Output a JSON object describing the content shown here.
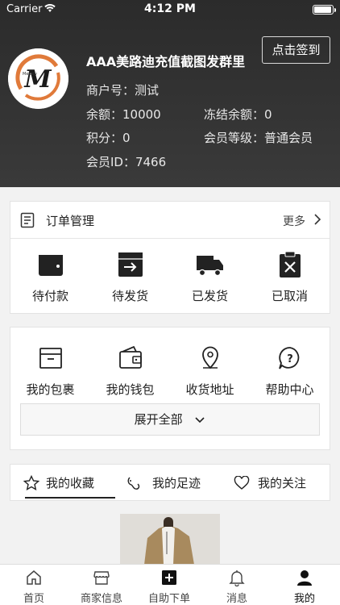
{
  "status_bar": {
    "carrier": "Carrier",
    "time": "4:12 PM",
    "battery_percent": 95
  },
  "profile": {
    "shop_name": "AAA美路迪充值截图发群里",
    "merchant_no": "商户号：测试",
    "balance": "余额：10000",
    "frozen_balance": "冻结余额：0",
    "points": "积分：0",
    "member_level": "会员等级：普通会员",
    "member_id": "会员ID：7466",
    "checkin_label": "点击签到",
    "avatar_text": "M",
    "avatar_small_text": "Melody"
  },
  "orders": {
    "title": "订单管理",
    "more_label": "更多",
    "items": [
      {
        "label": "待付款",
        "icon": "wallet-icon"
      },
      {
        "label": "待发货",
        "icon": "box-arrow-icon"
      },
      {
        "label": "已发货",
        "icon": "truck-icon"
      },
      {
        "label": "已取消",
        "icon": "cancelled-clipboard-icon"
      }
    ]
  },
  "services": {
    "items": [
      {
        "label": "我的包裹",
        "icon": "package-icon"
      },
      {
        "label": "我的钱包",
        "icon": "purse-icon"
      },
      {
        "label": "收货地址",
        "icon": "location-pin-icon"
      },
      {
        "label": "帮助中心",
        "icon": "help-icon"
      }
    ],
    "expand_label": "展开全部"
  },
  "collections": {
    "tabs": [
      {
        "label": "我的收藏",
        "icon": "star-icon",
        "active": true
      },
      {
        "label": "我的足迹",
        "icon": "footprint-icon",
        "active": false
      },
      {
        "label": "我的关注",
        "icon": "heart-icon",
        "active": false
      }
    ]
  },
  "tabbar": {
    "items": [
      {
        "label": "首页",
        "icon": "home-icon"
      },
      {
        "label": "商家信息",
        "icon": "store-icon"
      },
      {
        "label": "自助下单",
        "icon": "plus-square-icon"
      },
      {
        "label": "消息",
        "icon": "bell-icon"
      },
      {
        "label": "我的",
        "icon": "user-icon",
        "active": true
      }
    ]
  }
}
